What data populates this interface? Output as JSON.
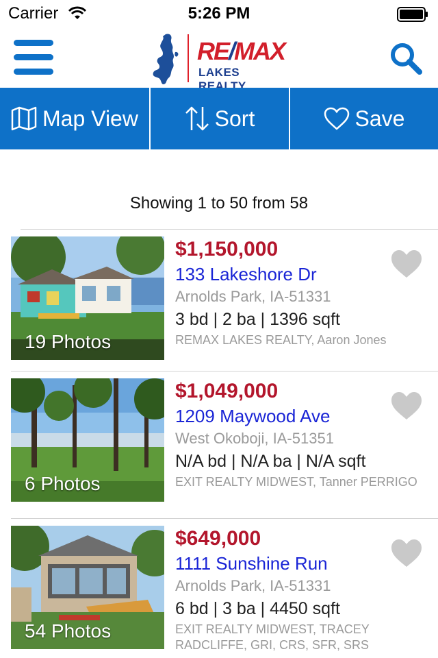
{
  "status": {
    "carrier": "Carrier",
    "time": "5:26 PM"
  },
  "header": {
    "logo_brand_re": "RE",
    "logo_brand_slash": "/",
    "logo_brand_max": "MAX",
    "logo_sub": "LAKES REALTY",
    "accent_color": "#0e71c8"
  },
  "toolbar": {
    "map_label": "Map View",
    "sort_label": "Sort",
    "save_label": "Save"
  },
  "results": {
    "summary": "Showing 1 to 50 from 58"
  },
  "listings": [
    {
      "photos_label": "19 Photos",
      "price": "$1,150,000",
      "address": "133 Lakeshore Dr",
      "city": "Arnolds Park, IA-51331",
      "specs": "3 bd | 2 ba | 1396 sqft",
      "agent": "REMAX LAKES REALTY, Aaron Jones"
    },
    {
      "photos_label": "6 Photos",
      "price": "$1,049,000",
      "address": "1209 Maywood Ave",
      "city": "West Okoboji, IA-51351",
      "specs": "N/A bd | N/A ba | N/A sqft",
      "agent": "EXIT REALTY MIDWEST, Tanner PERRIGO"
    },
    {
      "photos_label": "54 Photos",
      "price": "$649,000",
      "address": "1111 Sunshine Run",
      "city": "Arnolds Park, IA-51331",
      "specs": "6 bd | 3 ba | 4450 sqft",
      "agent": "EXIT REALTY MIDWEST, TRACEY RADCLIFFE, GRI, CRS, SFR, SRS"
    }
  ]
}
